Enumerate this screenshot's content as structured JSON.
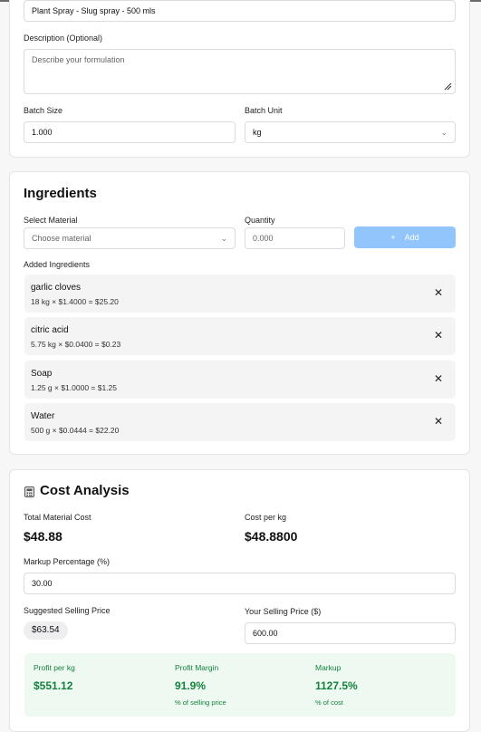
{
  "formulation": {
    "name_value": "Plant Spray - Slug spray - 500 mls",
    "description_label": "Description (Optional)",
    "description_placeholder": "Describe your formulation",
    "batch_size_label": "Batch Size",
    "batch_size_value": "1.000",
    "batch_unit_label": "Batch Unit",
    "batch_unit_value": "kg"
  },
  "ingredients": {
    "title": "Ingredients",
    "select_material_label": "Select Material",
    "select_material_placeholder": "Choose material",
    "quantity_label": "Quantity",
    "quantity_placeholder": "0.000",
    "add_label": "Add",
    "added_label": "Added Ingredients",
    "items": [
      {
        "name": "garlic cloves",
        "detail": "18 kg × $1.4000 = $25.20"
      },
      {
        "name": "citric acid",
        "detail": "5.75 kg × $0.0400 = $0.23"
      },
      {
        "name": "Soap",
        "detail": "1.25 g × $1.0000 = $1.25"
      },
      {
        "name": "Water",
        "detail": "500 g × $0.0444 = $22.20"
      }
    ]
  },
  "cost": {
    "title": "Cost Analysis",
    "icon": "calculator-icon",
    "total_material_label": "Total Material Cost",
    "total_material_value": "$48.88",
    "cost_per_label": "Cost per kg",
    "cost_per_value": "$48.8800",
    "markup_label": "Markup Percentage (%)",
    "markup_value": "30.00",
    "suggested_label": "Suggested Selling Price",
    "suggested_value": "$63.54",
    "your_price_label": "Your Selling Price ($)",
    "your_price_value": "600.00",
    "profit_per_label": "Profit per kg",
    "profit_per_value": "$551.12",
    "margin_label": "Profit Margin",
    "margin_value": "91.9%",
    "margin_sub": "% of selling price",
    "markup_result_label": "Markup",
    "markup_result_value": "1127.5%",
    "markup_result_sub": "% of cost"
  },
  "colors": {
    "accent_button": "#93c5fd",
    "profit_green": "#15803d",
    "profit_bg": "#eefaf1"
  }
}
